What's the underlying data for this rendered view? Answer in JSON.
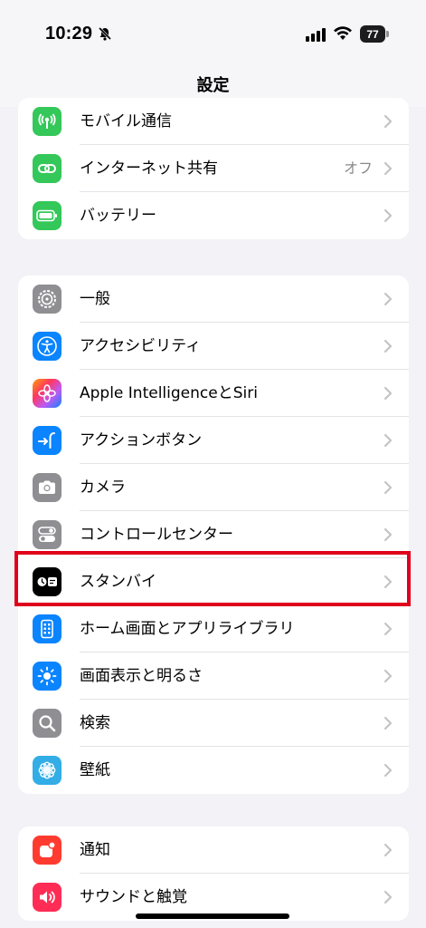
{
  "status": {
    "time": "10:29",
    "battery": "77"
  },
  "nav": {
    "title": "設定"
  },
  "groups": [
    {
      "items": [
        {
          "label": "モバイル通信",
          "value": "",
          "color": "#34c759",
          "icon": "antenna-icon"
        },
        {
          "label": "インターネット共有",
          "value": "オフ",
          "color": "#34c759",
          "icon": "chain-link-icon"
        },
        {
          "label": "バッテリー",
          "value": "",
          "color": "#34c759",
          "icon": "battery-icon"
        }
      ]
    },
    {
      "items": [
        {
          "label": "一般",
          "value": "",
          "color": "#8e8e93",
          "icon": "gear-icon"
        },
        {
          "label": "アクセシビリティ",
          "value": "",
          "color": "#0a84ff",
          "icon": "accessibility-icon"
        },
        {
          "label": "Apple IntelligenceとSiri",
          "value": "",
          "color": "#af52de",
          "icon": "apple-intelligence-icon"
        },
        {
          "label": "アクションボタン",
          "value": "",
          "color": "#0a84ff",
          "icon": "action-button-icon"
        },
        {
          "label": "カメラ",
          "value": "",
          "color": "#8e8e93",
          "icon": "camera-icon"
        },
        {
          "label": "コントロールセンター",
          "value": "",
          "color": "#8e8e93",
          "icon": "toggles-icon"
        },
        {
          "label": "スタンバイ",
          "value": "",
          "color": "#000000",
          "icon": "standby-icon"
        },
        {
          "label": "ホーム画面とアプリライブラリ",
          "value": "",
          "color": "#0a84ff",
          "icon": "home-screen-icon"
        },
        {
          "label": "画面表示と明るさ",
          "value": "",
          "color": "#0a84ff",
          "icon": "sun-icon"
        },
        {
          "label": "検索",
          "value": "",
          "color": "#8e8e93",
          "icon": "magnifier-icon"
        },
        {
          "label": "壁紙",
          "value": "",
          "color": "#32ade6",
          "icon": "flower-icon"
        }
      ]
    },
    {
      "items": [
        {
          "label": "通知",
          "value": "",
          "color": "#ff3b30",
          "icon": "bell-icon"
        },
        {
          "label": "サウンドと触覚",
          "value": "",
          "color": "#ff2d55",
          "icon": "speaker-icon"
        }
      ]
    }
  ]
}
